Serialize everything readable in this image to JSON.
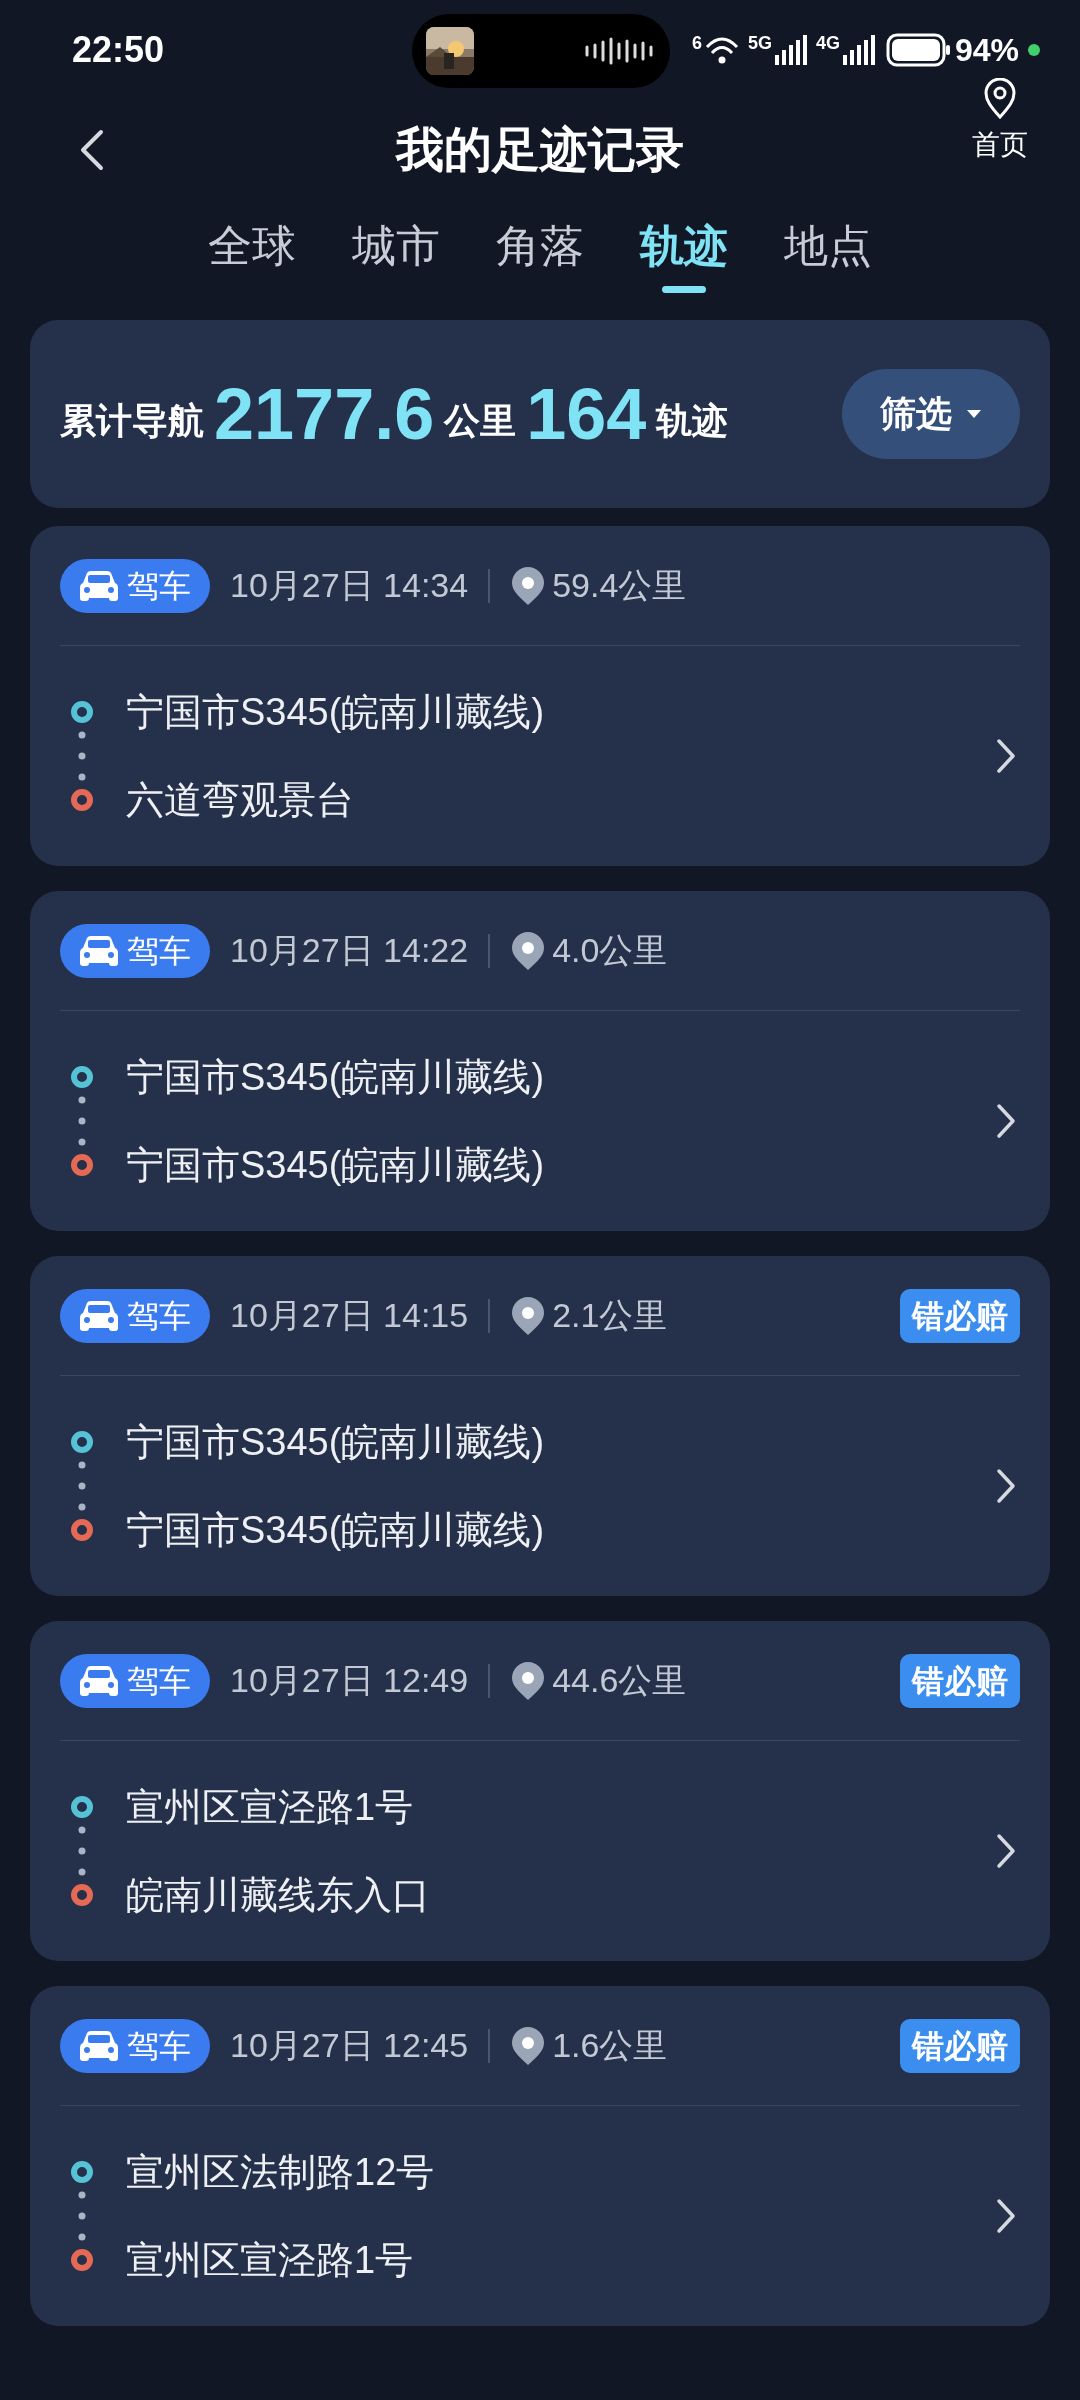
{
  "status_bar": {
    "time": "22:50",
    "wifi_label": "6",
    "network_1": "5G",
    "network_2": "4G",
    "battery": "94%"
  },
  "header": {
    "title": "我的足迹记录",
    "home_label": "首页"
  },
  "tabs": [
    {
      "label": "全球",
      "selected": false
    },
    {
      "label": "城市",
      "selected": false
    },
    {
      "label": "角落",
      "selected": false
    },
    {
      "label": "轨迹",
      "selected": true
    },
    {
      "label": "地点",
      "selected": false
    }
  ],
  "summary": {
    "label": "累计导航",
    "distance": "2177.6",
    "distance_unit": "公里",
    "count": "164",
    "count_unit": "轨迹",
    "filter_button": "筛选"
  },
  "trips": [
    {
      "mode": "驾车",
      "time": "10月27日 14:34",
      "distance": "59.4公里",
      "start": "宁国市S345(皖南川藏线)",
      "end": "六道弯观景台"
    },
    {
      "mode": "驾车",
      "time": "10月27日 14:22",
      "distance": "4.0公里",
      "start": "宁国市S345(皖南川藏线)",
      "end": "宁国市S345(皖南川藏线)"
    },
    {
      "mode": "驾车",
      "time": "10月27日 14:15",
      "distance": "2.1公里",
      "badge": "错必赔",
      "start": "宁国市S345(皖南川藏线)",
      "end": "宁国市S345(皖南川藏线)"
    },
    {
      "mode": "驾车",
      "time": "10月27日 12:49",
      "distance": "44.6公里",
      "badge": "错必赔",
      "start": "宣州区宣泾路1号",
      "end": "皖南川藏线东入口"
    },
    {
      "mode": "驾车",
      "time": "10月27日 12:45",
      "distance": "1.6公里",
      "badge": "错必赔",
      "start": "宣州区法制路12号",
      "end": "宣州区宣泾路1号"
    }
  ]
}
